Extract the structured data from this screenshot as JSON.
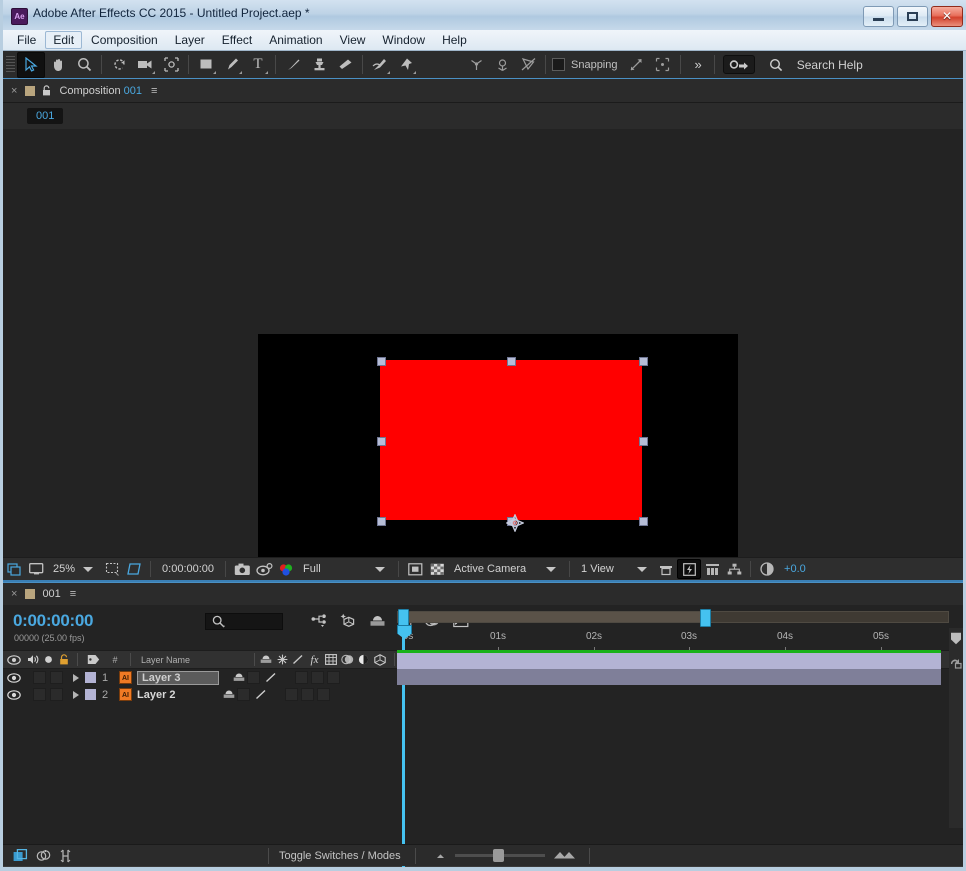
{
  "window": {
    "title": "Adobe After Effects CC 2015 - Untitled Project.aep *",
    "app_badge": "Ae",
    "controls": {
      "minimize": "–",
      "maximize": "▭",
      "close": "✕"
    }
  },
  "menu": {
    "items": [
      {
        "label": "File",
        "highlighted": false
      },
      {
        "label": "Edit",
        "highlighted": true
      },
      {
        "label": "Composition",
        "highlighted": false
      },
      {
        "label": "Layer",
        "highlighted": false
      },
      {
        "label": "Effect",
        "highlighted": false
      },
      {
        "label": "Animation",
        "highlighted": false
      },
      {
        "label": "View",
        "highlighted": false
      },
      {
        "label": "Window",
        "highlighted": false
      },
      {
        "label": "Help",
        "highlighted": false
      }
    ]
  },
  "toolbar": {
    "tools": [
      {
        "name": "selection-tool-icon",
        "active": true
      },
      {
        "name": "hand-tool-icon",
        "active": false
      },
      {
        "name": "zoom-tool-icon",
        "active": false
      },
      {
        "name": "rotation-tool-icon",
        "active": false
      },
      {
        "name": "camera-tool-icon",
        "active": false
      },
      {
        "name": "pan-behind-tool-icon",
        "active": false
      },
      {
        "name": "shape-tool-icon",
        "active": false
      },
      {
        "name": "pen-tool-icon",
        "active": false
      },
      {
        "name": "type-tool-icon",
        "active": false
      },
      {
        "name": "brush-tool-icon",
        "active": false
      },
      {
        "name": "clone-stamp-tool-icon",
        "active": false
      },
      {
        "name": "eraser-tool-icon",
        "active": false
      },
      {
        "name": "roto-brush-tool-icon",
        "active": false
      },
      {
        "name": "puppet-pin-tool-icon",
        "active": false
      }
    ],
    "axis_tools": [
      "local-axis-icon",
      "world-axis-icon",
      "view-axis-icon"
    ],
    "snapping_label": "Snapping",
    "snapping_checked": false,
    "overflow": "»",
    "search_help_placeholder": "Search Help"
  },
  "composition_panel": {
    "tab": {
      "close": "×",
      "title": "Composition",
      "comp_name": "001",
      "menu": "≡"
    },
    "breadcrumb": "001",
    "canvas": {
      "background_color": "#000000",
      "shape_color": "#ff0000",
      "selected": true,
      "handle_color": "#b6bdd6"
    }
  },
  "viewer_bar": {
    "zoom": "25%",
    "timecode": "0:00:00:00",
    "resolution": "Full",
    "view_camera": "Active Camera",
    "view_layout": "1 View",
    "exposure": "+0.0",
    "icons": [
      "always-preview-icon",
      "toggle-viewer-icon",
      "grid-guides-icon",
      "region-of-interest-icon",
      "snapshot-icon",
      "show-snapshot-icon",
      "channels-icon",
      "transparency-grid-icon",
      "mask-view-icon",
      "roi-icon",
      "fast-preview-icon",
      "timeline-icon",
      "flowchart-icon",
      "exposure-icon"
    ]
  },
  "timeline_panel": {
    "tab": {
      "close": "×",
      "comp_name": "001",
      "menu": "≡"
    },
    "current_time": "0:00:00:00",
    "frame_info": "00000 (25.00 fps)",
    "search_placeholder": "",
    "toolbar_icons": [
      "composition-mini-flowchart-icon",
      "draft-3d-icon",
      "hide-shy-layers-icon",
      "frame-blending-icon",
      "motion-blur-icon",
      "graph-editor-icon"
    ],
    "ruler": {
      "ticks": [
        "0s",
        "01s",
        "02s",
        "03s",
        "04s",
        "05s"
      ],
      "work_area_start": "0s",
      "work_area_end": "03s",
      "playhead": "0s"
    },
    "columns": {
      "video": "eye-icon",
      "audio": "speaker-icon",
      "solo": "solo-icon",
      "lock": "lock-icon",
      "label": "label-icon",
      "index": "#",
      "name": "Layer Name",
      "switches": [
        "shy-icon",
        "collapse-transformations-icon",
        "quality-icon",
        "effects-icon",
        "frame-blend-icon",
        "motion-blur-icon",
        "adjustment-layer-icon",
        "three-d-layer-icon"
      ]
    },
    "layers": [
      {
        "index": "1",
        "name": "Layer 3",
        "source_type": "AI",
        "selected": true,
        "editing_name": true,
        "visible": true,
        "label_color": "#b3b3d4",
        "bar_color": "#b3b3d4"
      },
      {
        "index": "2",
        "name": "Layer 2",
        "source_type": "AI",
        "selected": false,
        "editing_name": false,
        "visible": true,
        "label_color": "#b3b3d4",
        "bar_color": "#7f7f99"
      }
    ]
  },
  "bottom_bar": {
    "icons": [
      "frame-blending-toggle-icon",
      "motion-blur-toggle-icon",
      "brainstorm-icon"
    ],
    "toggle_label": "Toggle Switches / Modes",
    "zoom_small": "small-thumbnails-icon",
    "zoom_large": "large-thumbnails-icon"
  }
}
